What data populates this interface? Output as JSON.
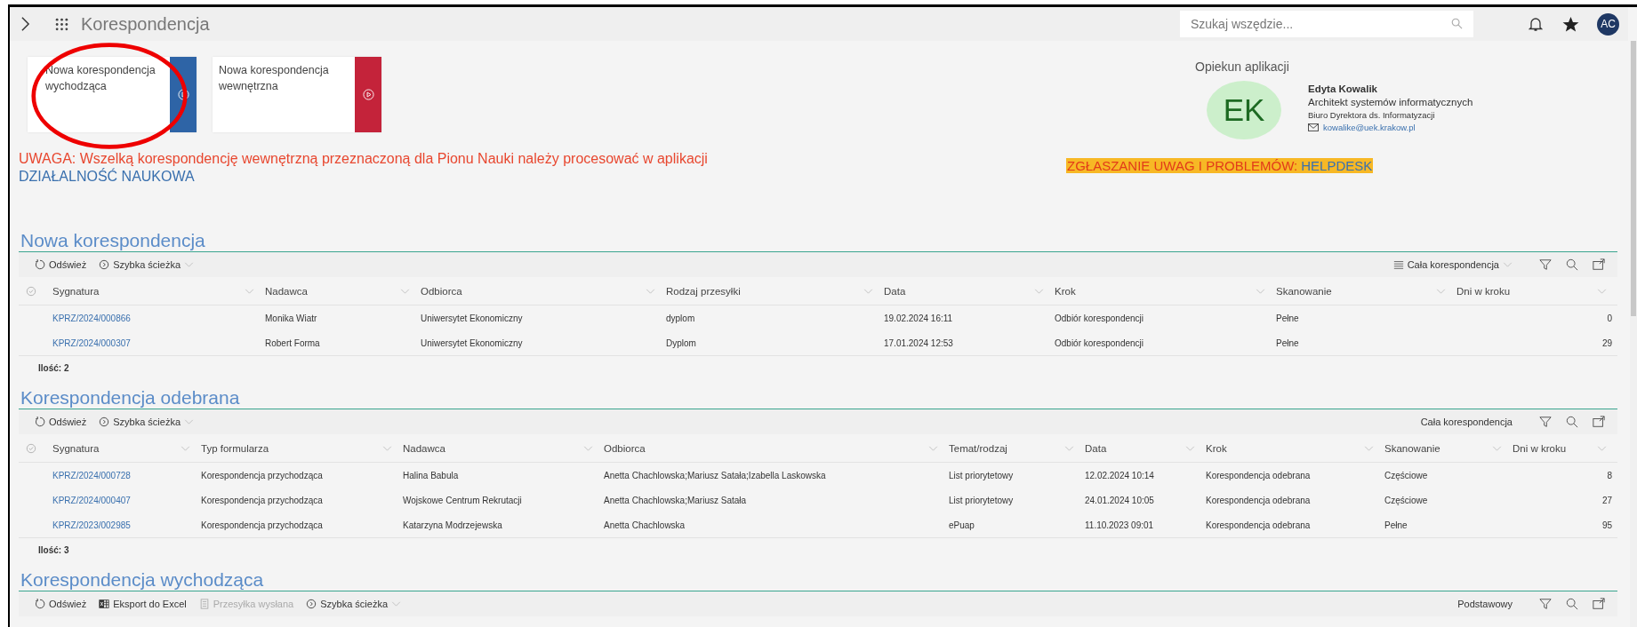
{
  "topbar": {
    "title": "Korespondencja",
    "search": {
      "placeholder": "Szukaj wszędzie..."
    },
    "avatar": "AC"
  },
  "tiles": [
    {
      "label": "Nowa korespondencja wychodząca",
      "color": "#2e64a6"
    },
    {
      "label": "Nowa korespondencja wewnętrzna",
      "color": "#c4233a"
    }
  ],
  "notice": {
    "text": "UWAGA: Wszelką korespondencję wewnętrzną przeznaczoną dla Pionu Nauki należy procesować w aplikacji",
    "link": "DZIAŁALNOŚĆ NAUKOWA"
  },
  "contact": {
    "heading": "Opiekun aplikacji",
    "initials": "EK",
    "name": "Edyta Kowalik",
    "role": "Architekt systemów informatycznych",
    "department": "Biuro Dyrektora ds. Informatyzacji",
    "email": "kowalike@uek.krakow.pl"
  },
  "helpdesk": {
    "text": "ZGŁASZANIE UWAG I PROBLEMÓW:",
    "link": "HELPDESK"
  },
  "sections": [
    {
      "title": "Nowa korespondencja",
      "toolbar": [
        {
          "kind": "refresh",
          "label": "Odśwież",
          "disabled": false
        },
        {
          "kind": "path",
          "label": "Szybka ścieżka",
          "disabled": false
        }
      ],
      "view": {
        "label": "Cała korespondencja",
        "list_icon": true,
        "dropdown": true
      },
      "table": {
        "columns": [
          "Sygnatura",
          "Nadawca",
          "Odbiorca",
          "Rodzaj przesyłki",
          "Data",
          "Krok",
          "Skanowanie",
          "Dni w kroku"
        ],
        "rows": [
          [
            "KPRZ/2024/000866",
            "Monika Wiatr",
            "Uniwersytet Ekonomiczny",
            "dyplom",
            "19.02.2024 16:11",
            "Odbiór korespondencji",
            "Pełne",
            "0"
          ],
          [
            "KPRZ/2024/000307",
            "Robert Forma",
            "Uniwersytet Ekonomiczny",
            "Dyplom",
            "17.01.2024 12:53",
            "Odbiór korespondencji",
            "Pełne",
            "29"
          ]
        ],
        "count": "Ilość: 2"
      }
    },
    {
      "title": "Korespondencja odebrana",
      "toolbar": [
        {
          "kind": "refresh",
          "label": "Odśwież",
          "disabled": false
        },
        {
          "kind": "path",
          "label": "Szybka ścieżka",
          "disabled": false
        }
      ],
      "view": {
        "label": "Cała korespondencja",
        "list_icon": false,
        "dropdown": false
      },
      "table": {
        "columns": [
          "Sygnatura",
          "Typ formularza",
          "Nadawca",
          "Odbiorca",
          "Temat/rodzaj",
          "Data",
          "Krok",
          "Skanowanie",
          "Dni w kroku"
        ],
        "rows": [
          [
            "KPRZ/2024/000728",
            "Korespondencja przychodząca",
            "Halina Babula",
            "Anetta Chachlowska;Mariusz Satała;Izabella Laskowska",
            "List priorytetowy",
            "12.02.2024 10:14",
            "Korespondencja odebrana",
            "Częściowe",
            "8"
          ],
          [
            "KPRZ/2024/000407",
            "Korespondencja przychodząca",
            "Wojskowe Centrum Rekrutacji",
            "Anetta Chachlowska;Mariusz Satała",
            "List priorytetowy",
            "24.01.2024 10:05",
            "Korespondencja odebrana",
            "Częściowe",
            "27"
          ],
          [
            "KPRZ/2023/002985",
            "Korespondencja przychodząca",
            "Katarzyna Modrzejewska",
            "Anetta Chachlowska",
            "ePuap",
            "11.10.2023 09:01",
            "Korespondencja odebrana",
            "Pełne",
            "95"
          ]
        ],
        "count": "Ilość: 3"
      }
    },
    {
      "title": "Korespondencja wychodząca",
      "toolbar": [
        {
          "kind": "refresh",
          "label": "Odśwież",
          "disabled": false
        },
        {
          "kind": "excel",
          "label": "Eksport do Excel",
          "disabled": false
        },
        {
          "kind": "sent",
          "label": "Przesyłka wysłana",
          "disabled": true
        },
        {
          "kind": "path",
          "label": "Szybka ścieżka",
          "disabled": false
        }
      ],
      "view": {
        "label": "Podstawowy",
        "list_icon": false,
        "dropdown": false
      }
    }
  ]
}
